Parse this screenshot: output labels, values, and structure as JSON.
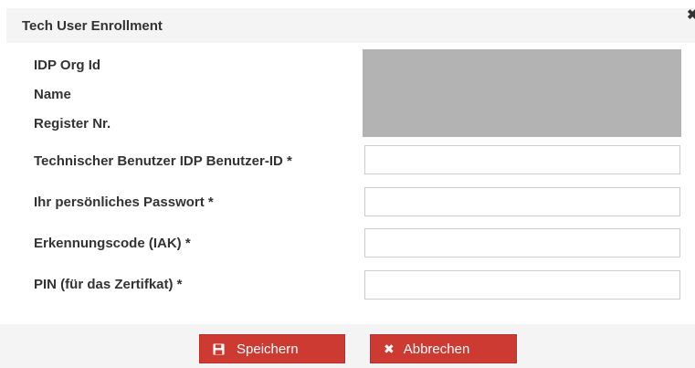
{
  "dialog": {
    "title": "Tech User Enrollment",
    "close_icon": "close-icon"
  },
  "fields": {
    "org_id_label": "IDP Org Id",
    "name_label": "Name",
    "register_label": "Register Nr.",
    "user_id_label": "Technischer Benutzer IDP Benutzer-ID *",
    "password_label": "Ihr persönliches Passwort *",
    "iak_label": "Erkennungscode (IAK) *",
    "pin_label": "PIN (für das Zertifkat) *",
    "user_id_value": "",
    "password_value": "",
    "iak_value": "",
    "pin_value": ""
  },
  "buttons": {
    "save_label": "Speichern",
    "save_icon": "floppy-disk-icon",
    "cancel_label": "Abbrechen",
    "cancel_icon": "x-icon"
  },
  "colors": {
    "button_red": "#cc3a32",
    "readonly_grey": "#b3b3b3",
    "header_bg": "#f4f4f4"
  }
}
